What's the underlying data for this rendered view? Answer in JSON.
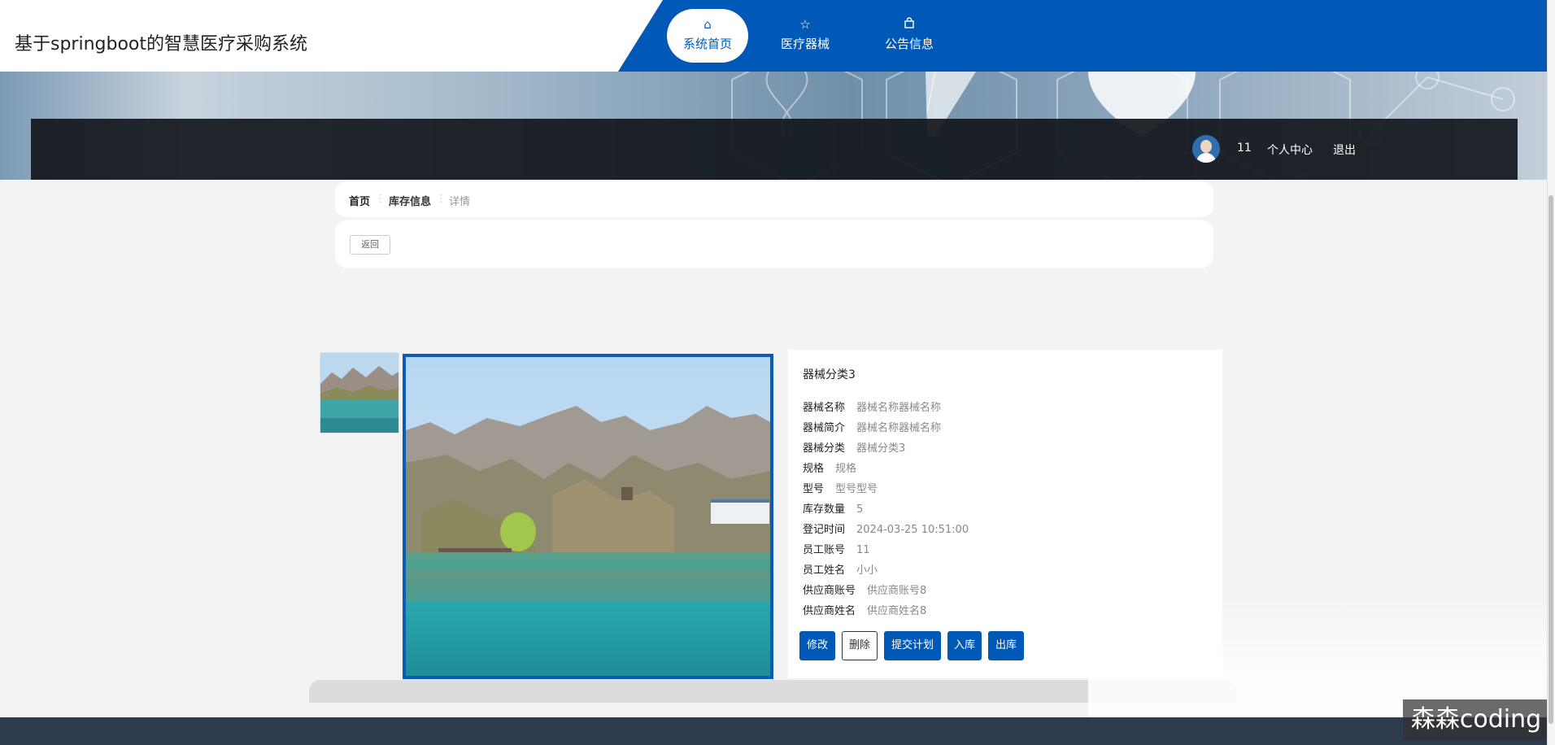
{
  "header": {
    "site_title": "基于springboot的智慧医疗采购系统",
    "nav": [
      {
        "label": "系统首页",
        "icon": "home-icon",
        "active": true
      },
      {
        "label": "医疗器械",
        "icon": "star-icon",
        "active": false
      },
      {
        "label": "公告信息",
        "icon": "bag-icon",
        "active": false
      }
    ]
  },
  "user_bar": {
    "username": "11",
    "personal_center": "个人中心",
    "logout": "退出"
  },
  "breadcrumb": {
    "home": "首页",
    "stock": "库存信息",
    "detail": "详情",
    "separator": "⋮"
  },
  "back_button": "返回",
  "detail": {
    "category_title": "器械分类3",
    "fields": [
      {
        "key": "器械名称",
        "value": "器械名称器械名称"
      },
      {
        "key": "器械简介",
        "value": "器械名称器械名称"
      },
      {
        "key": "器械分类",
        "value": "器械分类3"
      },
      {
        "key": "规格",
        "value": "规格"
      },
      {
        "key": "型号",
        "value": "型号型号"
      },
      {
        "key": "库存数量",
        "value": "5"
      },
      {
        "key": "登记时间",
        "value": "2024-03-25 10:51:00"
      },
      {
        "key": "员工账号",
        "value": "11"
      },
      {
        "key": "员工姓名",
        "value": "小小"
      },
      {
        "key": "供应商账号",
        "value": "供应商账号8"
      },
      {
        "key": "供应商姓名",
        "value": "供应商姓名8"
      }
    ],
    "buttons": {
      "edit": "修改",
      "delete": "删除",
      "submit_plan": "提交计划",
      "stock_in": "入库",
      "stock_out": "出库"
    }
  },
  "watermark": "森森coding",
  "colors": {
    "primary": "#0059b7",
    "footer": "#2e3a4e",
    "page_bg": "#f3f3f3"
  }
}
